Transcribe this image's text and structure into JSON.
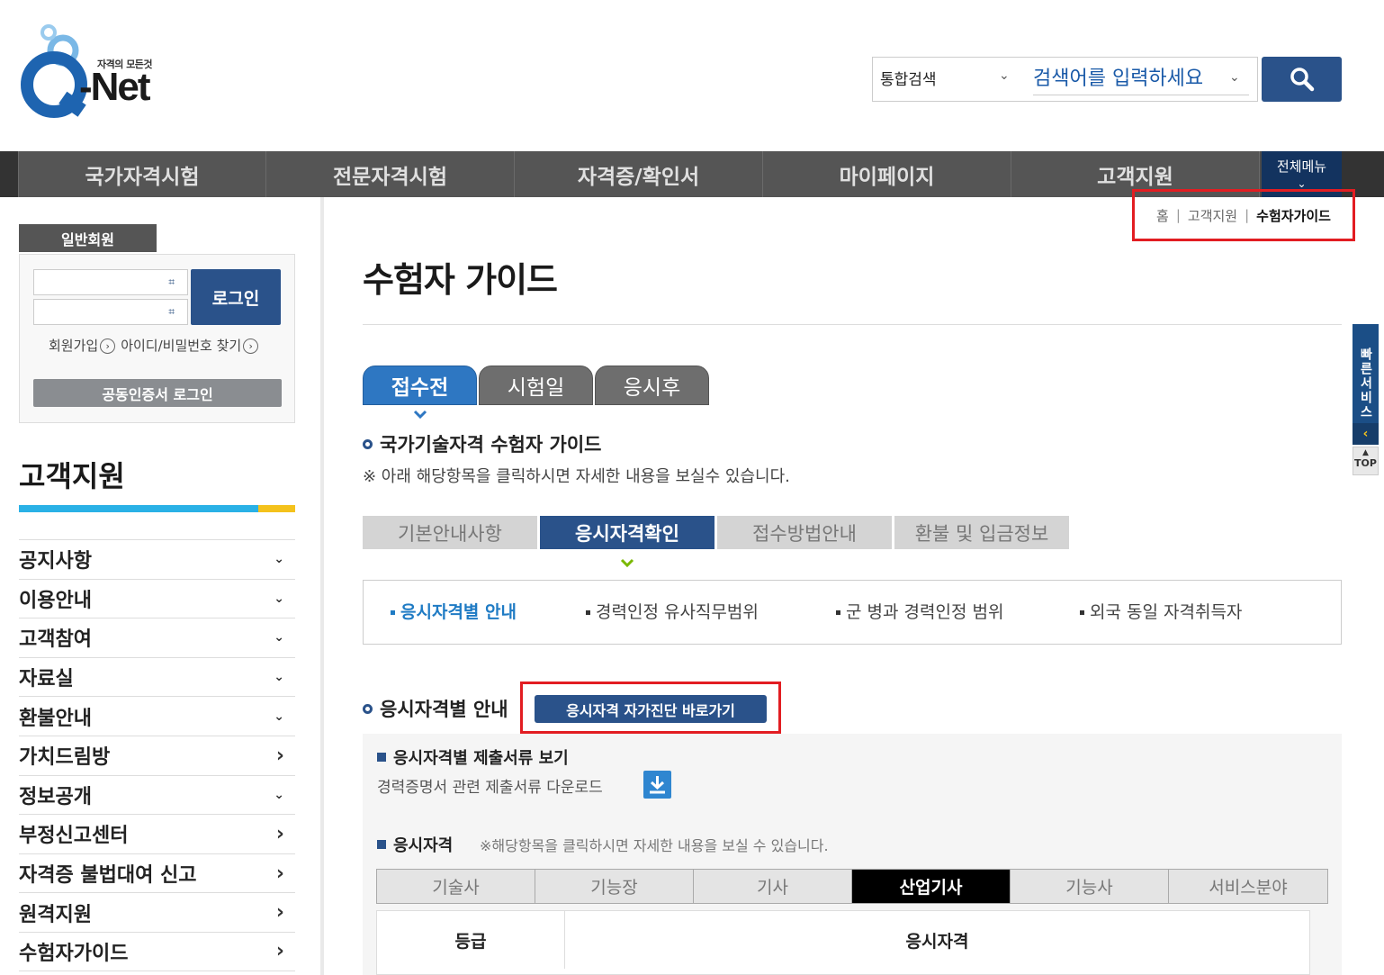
{
  "logo": {
    "tagline": "자격의 모든것",
    "brand": "-Net"
  },
  "search": {
    "category": "통합검색",
    "placeholder": "검색어를 입력하세요"
  },
  "gnb": {
    "items": [
      "국가자격시험",
      "전문자격시험",
      "자격증/확인서",
      "마이페이지",
      "고객지원"
    ],
    "all_menu": "전체메뉴"
  },
  "login": {
    "member_tab": "일반회원",
    "login_button": "로그인",
    "join_link": "회원가입",
    "find_link": "아이디/비밀번호 찾기",
    "cert_button": "공동인증서 로그인"
  },
  "sidebar": {
    "title": "고객지원",
    "items": [
      {
        "label": "공지사항",
        "arrow": "down"
      },
      {
        "label": "이용안내",
        "arrow": "down"
      },
      {
        "label": "고객참여",
        "arrow": "down"
      },
      {
        "label": "자료실",
        "arrow": "down"
      },
      {
        "label": "환불안내",
        "arrow": "down"
      },
      {
        "label": "가치드림방",
        "arrow": "right"
      },
      {
        "label": "정보공개",
        "arrow": "down"
      },
      {
        "label": "부정신고센터",
        "arrow": "right"
      },
      {
        "label": "자격증 불법대여 신고",
        "arrow": "right"
      },
      {
        "label": "원격지원",
        "arrow": "right"
      },
      {
        "label": "수험자가이드",
        "arrow": "right"
      }
    ]
  },
  "breadcrumb": {
    "home": "홈",
    "parent": "고객지원",
    "current": "수험자가이드"
  },
  "page": {
    "title": "수험자 가이드"
  },
  "phase_tabs": {
    "items": [
      "접수전",
      "시험일",
      "응시후"
    ],
    "active": 0
  },
  "section1": {
    "heading": "국가기술자격 수험자 가이드",
    "note": "※ 아래 해당항목을 클릭하시면 자세한 내용을 보실수 있습니다."
  },
  "sub_tabs": {
    "items": [
      "기본안내사항",
      "응시자격확인",
      "접수방법안내",
      "환불 및 입금정보"
    ],
    "active": 1
  },
  "sub_links": {
    "items": [
      "응시자격별 안내",
      "경력인정 유사직무범위",
      "군 병과 경력인정 범위",
      "외국 동일 자격취득자"
    ],
    "active": 0
  },
  "section2": {
    "heading": "응시자격별 안내",
    "self_check_button": "응시자격 자가진단 바로가기",
    "docs_heading": "응시자격별 제출서류 보기",
    "docs_text": "경력증명서 관련 제출서류 다운로드",
    "qual_heading": "응시자격",
    "qual_note": "※해당항목을 클릭하시면 자세한 내용을 보실 수 있습니다."
  },
  "grade_tabs": {
    "items": [
      "기술사",
      "기능장",
      "기사",
      "산업기사",
      "기능사",
      "서비스분야"
    ],
    "active": 3
  },
  "table": {
    "headers": [
      "등급",
      "응시자격"
    ]
  },
  "quick": {
    "label": "빠른서비스",
    "top": "TOP"
  },
  "colors": {
    "primary": "#2a528a",
    "accent_blue": "#2e77c2",
    "highlight_red": "#e21d22",
    "bar_yellow": "#f4c21c",
    "bar_cyan": "#2ab1e6"
  }
}
